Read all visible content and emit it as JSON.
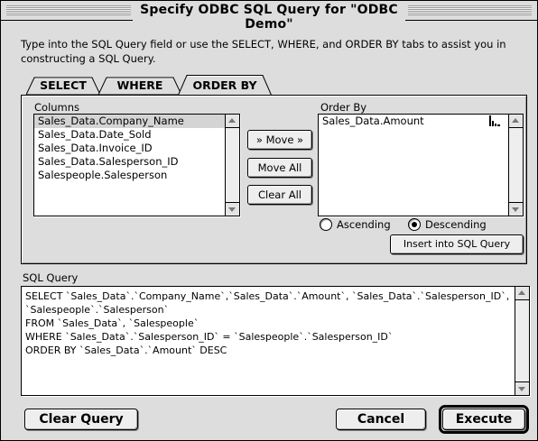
{
  "window": {
    "title": "Specify ODBC SQL Query for \"ODBC Demo\""
  },
  "instructions": "Type into the SQL Query field or use the SELECT, WHERE, and ORDER BY tabs to assist you in constructing a SQL Query.",
  "tabs": [
    {
      "label": "SELECT",
      "active": false
    },
    {
      "label": "WHERE",
      "active": false
    },
    {
      "label": "ORDER BY",
      "active": true
    }
  ],
  "columns": {
    "label": "Columns",
    "items": [
      {
        "label": "Sales_Data.Company_Name",
        "selected": true
      },
      {
        "label": "Sales_Data.Date_Sold",
        "selected": false
      },
      {
        "label": "Sales_Data.Invoice_ID",
        "selected": false
      },
      {
        "label": "Sales_Data.Salesperson_ID",
        "selected": false
      },
      {
        "label": "Salespeople.Salesperson",
        "selected": false
      }
    ]
  },
  "buttons": {
    "move": "» Move »",
    "move_all": "Move All",
    "clear_all": "Clear All",
    "insert": "Insert into SQL Query",
    "clear_query": "Clear Query",
    "cancel": "Cancel",
    "execute": "Execute"
  },
  "order_by": {
    "label": "Order By",
    "items": [
      {
        "label": "Sales_Data.Amount"
      }
    ],
    "sort_icon": "sort-descending-icon"
  },
  "sort_options": {
    "ascending": "Ascending",
    "descending": "Descending",
    "selected": "descending"
  },
  "sql_query": {
    "label": "SQL Query",
    "value": "SELECT `Sales_Data`.`Company_Name`,`Sales_Data`.`Amount`, `Sales_Data`.`Salesperson_ID`,\n`Salespeople`.`Salesperson`\nFROM `Sales_Data`, `Salespeople`\nWHERE `Sales_Data`.`Salesperson_ID` = `Salespeople`.`Salesperson_ID`\nORDER BY `Sales_Data`.`Amount` DESC"
  }
}
